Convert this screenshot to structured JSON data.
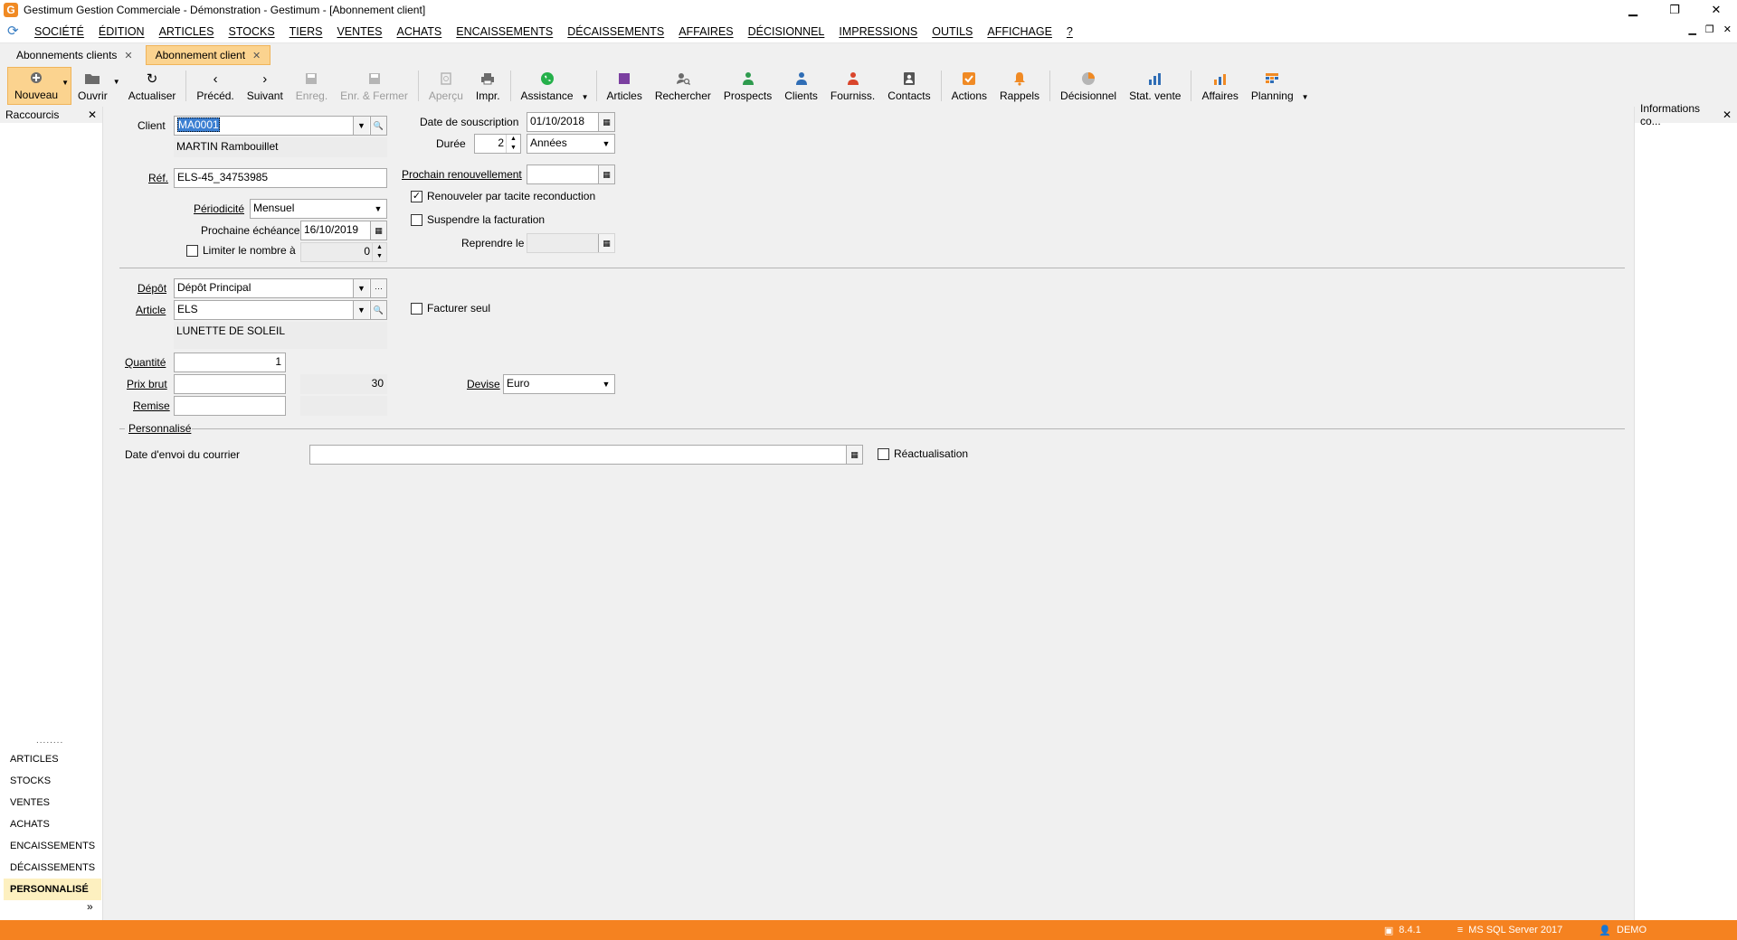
{
  "window": {
    "title": "Gestimum Gestion Commerciale - Démonstration - Gestimum - [Abonnement client]",
    "minimize": "▁",
    "restore": "❐",
    "close": "✕"
  },
  "menu": [
    "SOCIÉTÉ",
    "ÉDITION",
    "ARTICLES",
    "STOCKS",
    "TIERS",
    "VENTES",
    "ACHATS",
    "ENCAISSEMENTS",
    "DÉCAISSEMENTS",
    "AFFAIRES",
    "DÉCISIONNEL",
    "IMPRESSIONS",
    "OUTILS",
    "AFFICHAGE",
    "?"
  ],
  "doc_tabs": [
    {
      "label": "Abonnements clients",
      "active": false
    },
    {
      "label": "Abonnement client",
      "active": true
    }
  ],
  "toolbar": {
    "nouveau": "Nouveau",
    "ouvrir": "Ouvrir",
    "actualiser": "Actualiser",
    "preced": "Précéd.",
    "suivant": "Suivant",
    "enreg": "Enreg.",
    "enr_fermer": "Enr. & Fermer",
    "apercu": "Aperçu",
    "impr": "Impr.",
    "assistance": "Assistance",
    "articles": "Articles",
    "rechercher": "Rechercher",
    "prospects": "Prospects",
    "clients": "Clients",
    "fourniss": "Fourniss.",
    "contacts": "Contacts",
    "actions": "Actions",
    "rappels": "Rappels",
    "decisionnel": "Décisionnel",
    "stat_vente": "Stat. vente",
    "affaires": "Affaires",
    "planning": "Planning"
  },
  "left_panel": {
    "title": "Raccourcis",
    "grip": "........",
    "sections": [
      "ARTICLES",
      "STOCKS",
      "VENTES",
      "ACHATS",
      "ENCAISSEMENTS",
      "DÉCAISSEMENTS",
      "PERSONNALISÉ"
    ],
    "active_section": "PERSONNALISÉ",
    "expand": "»"
  },
  "right_panel": {
    "title": "Informations co..."
  },
  "form": {
    "client_label": "Client",
    "client_value": "MA0001",
    "client_name": "MARTIN Rambouillet",
    "ref_label": "Réf.",
    "ref_value": "ELS-45_34753985",
    "periodicite_label": "Périodicité",
    "periodicite_value": "Mensuel",
    "prochaine_echeance_label": "Prochaine échéance",
    "prochaine_echeance_value": "16/10/2019",
    "limiter_label": "Limiter le nombre à",
    "limiter_value": "0",
    "date_souscription_label": "Date de souscription",
    "date_souscription_value": "01/10/2018",
    "duree_label": "Durée",
    "duree_value": "2",
    "duree_unit": "Années",
    "prochain_renouvellement_label": "Prochain renouvellement",
    "prochain_renouvellement_value": "",
    "renouveler_label": "Renouveler par tacite reconduction",
    "suspendre_label": "Suspendre la facturation",
    "reprendre_label": "Reprendre le",
    "reprendre_value": "",
    "depot_label": "Dépôt",
    "depot_value": "Dépôt Principal",
    "article_label": "Article",
    "article_value": "ELS",
    "article_name": "LUNETTE DE SOLEIL",
    "facturer_seul_label": "Facturer seul",
    "quantite_label": "Quantité",
    "quantite_value": "1",
    "prix_brut_label": "Prix brut",
    "prix_brut_value": "",
    "prix_brut_ref": "30",
    "remise_label": "Remise",
    "remise_value": "",
    "devise_label": "Devise",
    "devise_value": "Euro",
    "personnalise_label": "Personnalisé",
    "date_envoi_label": "Date d'envoi du courrier",
    "date_envoi_value": "",
    "reactualisation_label": "Réactualisation"
  },
  "status": {
    "version": "8.4.1",
    "db": "MS SQL Server 2017",
    "user": "DEMO"
  },
  "colors": {
    "accent": "#f58220",
    "active_tab": "#fbd38f",
    "selection": "#3b7fd2"
  }
}
